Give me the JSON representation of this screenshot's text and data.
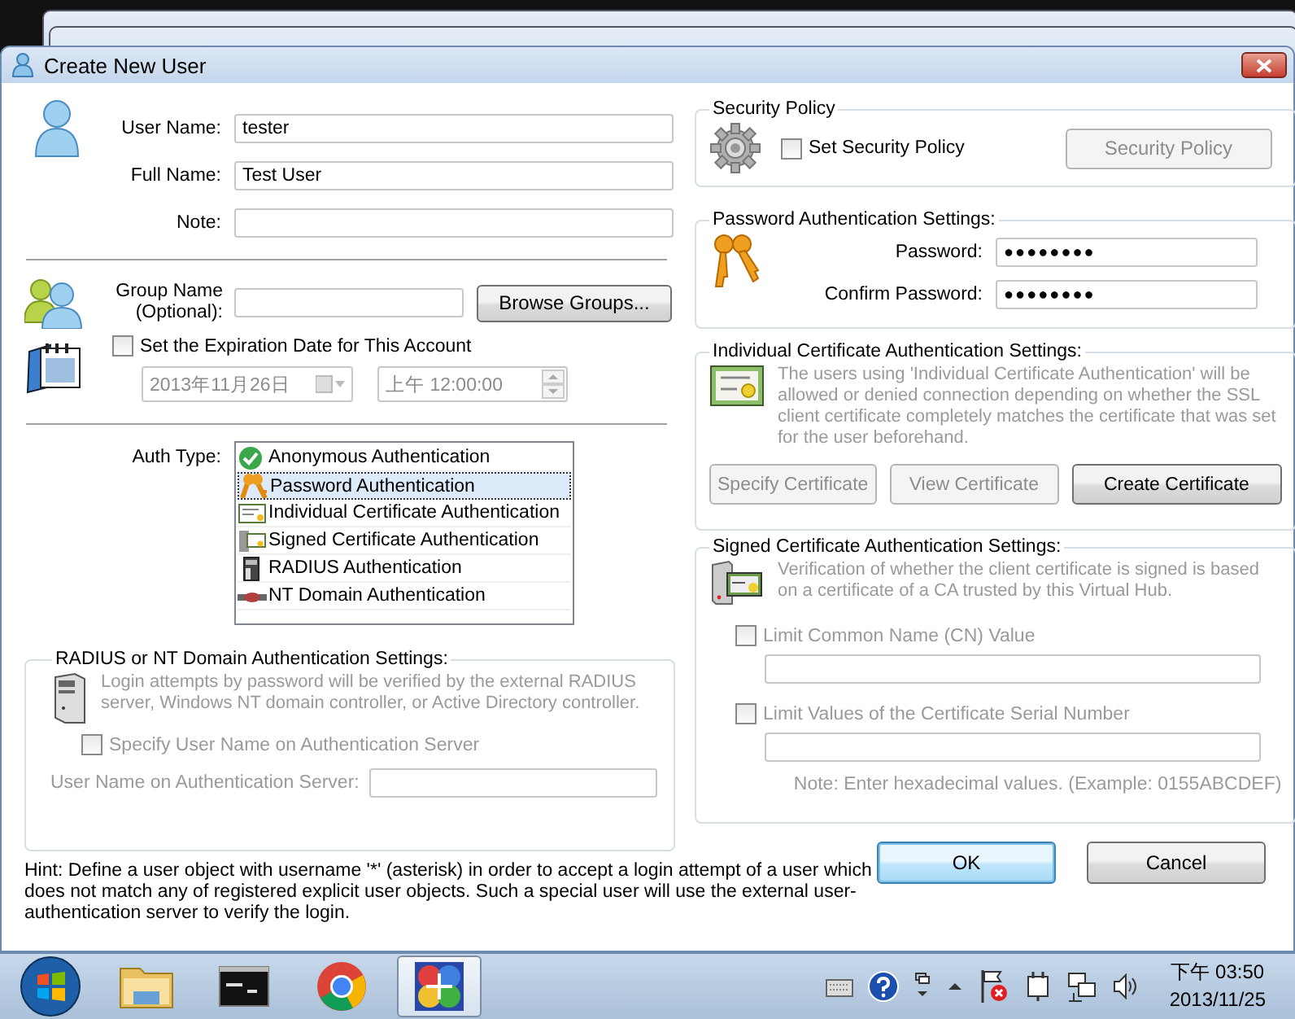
{
  "dialog": {
    "title": "Create New User"
  },
  "user_fields": [
    {
      "label": "User Name:",
      "value": "tester"
    },
    {
      "label": "Full Name:",
      "value": "Test User"
    },
    {
      "label": "Note:"
    }
  ],
  "group": {
    "label_lines": [
      "Group Name",
      "(Optional):"
    ],
    "button": "Browse Groups..."
  },
  "expiration": {
    "label": "Set the Expiration Date for This Account",
    "checked": false,
    "date": "2013年11月26日",
    "time": "上午 12:00:00",
    "disabled": true
  },
  "auth_type": {
    "label": "Auth Type:",
    "options": [
      {
        "label": "Anonymous Authentication",
        "kind": "check",
        "selected": false
      },
      {
        "label": "Password Authentication",
        "kind": "keys",
        "selected": true
      },
      {
        "label": "Individual Certificate Authentication",
        "kind": "certificate",
        "selected": false
      },
      {
        "label": "Signed Certificate Authentication",
        "kind": "signed",
        "selected": false
      },
      {
        "label": "RADIUS Authentication",
        "kind": "server",
        "selected": false
      },
      {
        "label": "NT Domain Authentication",
        "kind": "domain",
        "selected": false
      }
    ]
  },
  "radius": {
    "title": "RADIUS or NT Domain Authentication Settings:",
    "disabled": true,
    "description": "Login attempts by password will be verified by the external RADIUS server, Windows NT domain controller, or Active Directory controller.",
    "specify": {
      "label": "Specify User Name on Authentication Server",
      "checked": false
    },
    "server_user": {
      "label": "User Name on Authentication Server:"
    }
  },
  "hint": "Hint: Define a user object with username '*' (asterisk) in order to accept a login attempt of a user which does not match any of registered explicit user objects. Such a special user will use the external user-authentication server to verify the login.",
  "security_policy": {
    "title": "Security Policy",
    "checkbox": {
      "label": "Set Security Policy",
      "checked": false
    },
    "button": {
      "label": "Security Policy",
      "disabled": true
    }
  },
  "password": {
    "title": "Password Authentication Settings:",
    "fields": [
      {
        "label": "Password:",
        "value": "●●●●●●●●"
      },
      {
        "label": "Confirm Password:",
        "value": "●●●●●●●●"
      }
    ]
  },
  "individual_cert": {
    "title": "Individual Certificate Authentication Settings:",
    "disabled": true,
    "description": "The users using 'Individual Certificate Authentication' will be allowed or denied connection depending on whether the SSL client certificate completely matches the certificate that was set for the user beforehand.",
    "buttons": [
      {
        "label": "Specify Certificate",
        "disabled": true
      },
      {
        "label": "View Certificate",
        "disabled": true
      },
      {
        "label": "Create Certificate",
        "disabled": false
      }
    ]
  },
  "signed_cert": {
    "title": "Signed Certificate Authentication Settings:",
    "disabled": true,
    "description": "Verification of whether the client certificate is signed is based on a certificate of a CA trusted by this Virtual Hub.",
    "options": [
      {
        "label": "Limit Common Name (CN) Value",
        "checked": false
      },
      {
        "label": "Limit Values of the Certificate Serial Number",
        "checked": false
      }
    ],
    "note": "Note: Enter hexadecimal values. (Example: 0155ABCDEF)"
  },
  "buttons": [
    {
      "label": "OK",
      "default": true
    },
    {
      "label": "Cancel",
      "default": false
    }
  ],
  "taskbar": {
    "apps": [
      {
        "kind": "folder",
        "selected": false
      },
      {
        "kind": "terminal",
        "selected": false
      },
      {
        "kind": "browser",
        "selected": false
      },
      {
        "kind": "vpn",
        "selected": true
      }
    ],
    "clock": {
      "time": "下午 03:50",
      "date": "2013/11/25"
    }
  }
}
